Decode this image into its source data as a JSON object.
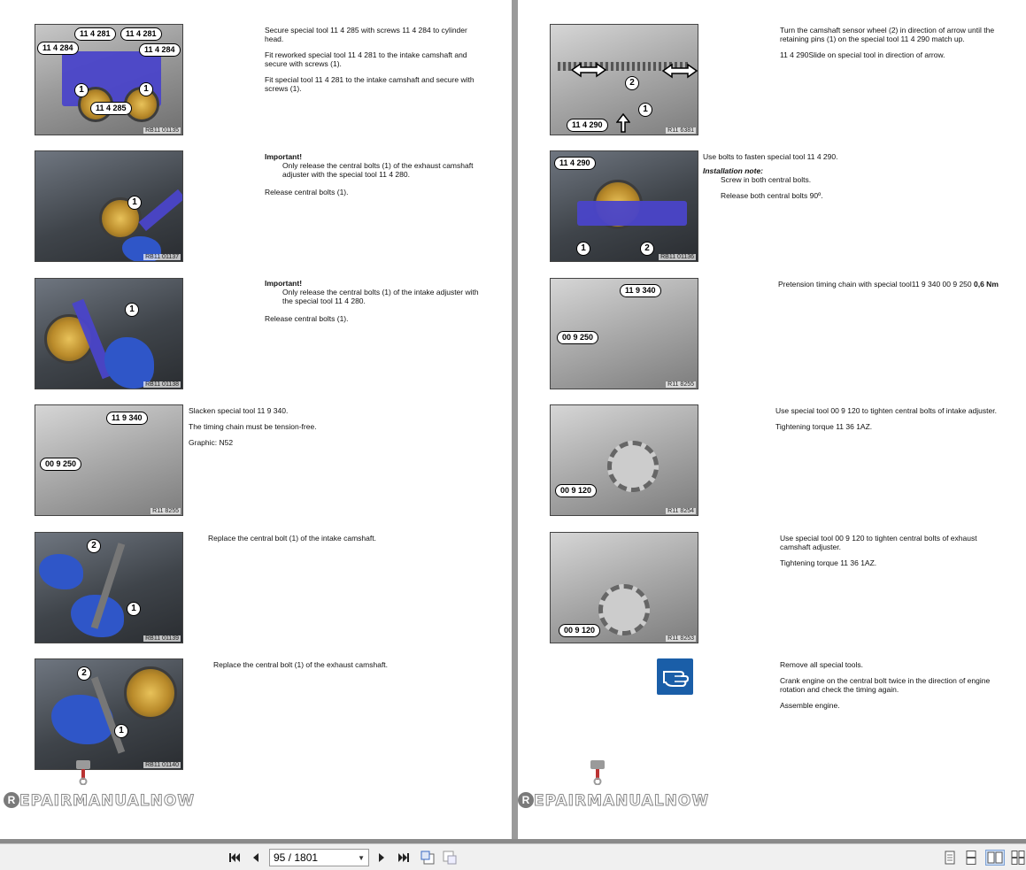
{
  "left_page": {
    "steps": [
      {
        "figure_ref": "RB11 01135",
        "labels": [
          "11 4 281",
          "11 4 281",
          "11 4 284",
          "11 4 284",
          "11 4 285"
        ],
        "numbers": [
          "1",
          "1"
        ],
        "paragraphs": [
          "Secure special tool 11 4 285 with screws 11 4 284 to cylinder head.",
          "Fit reworked special tool 11 4 281 to the intake camshaft and secure with screws (1).",
          "Fit special tool 11 4 281 to the intake camshaft and secure with screws (1)."
        ]
      },
      {
        "figure_ref": "RB11 01137",
        "numbers": [
          "1"
        ],
        "important": "Important!",
        "important_text": "Only release the central bolts (1) of the exhaust camshaft adjuster with the special tool 11 4 280.",
        "paragraphs": [
          "Release central bolts (1)."
        ]
      },
      {
        "figure_ref": "RB11 01138",
        "numbers": [
          "1"
        ],
        "important": "Important!",
        "important_text": "Only release the central bolts (1) of the intake adjuster with the special tool 11 4 280.",
        "paragraphs": [
          "Release central bolts (1)."
        ]
      },
      {
        "figure_ref": "R11 8255",
        "labels": [
          "11 9 340",
          "00 9 250"
        ],
        "paragraphs": [
          "Slacken special tool 11 9 340.",
          "The timing chain must be tension-free.",
          "Graphic: N52"
        ]
      },
      {
        "figure_ref": "RB11 01139",
        "numbers": [
          "2",
          "1"
        ],
        "paragraphs": [
          "Replace the central bolt (1) of the intake camshaft."
        ]
      },
      {
        "figure_ref": "RB11 01140",
        "numbers": [
          "2",
          "1"
        ],
        "paragraphs": [
          "Replace the central bolt (1) of the exhaust camshaft."
        ]
      }
    ]
  },
  "right_page": {
    "steps": [
      {
        "figure_ref": "R11 6381",
        "labels": [
          "11 4 290"
        ],
        "numbers": [
          "2",
          "1"
        ],
        "paragraphs": [
          "Turn the camshaft sensor wheel (2) in direction of arrow until the retaining pins (1) on the special tool 11 4 290 match up.",
          "11 4 290Slide on special tool in direction of arrow."
        ]
      },
      {
        "figure_ref": "RB11 01136",
        "labels": [
          "11 4 290"
        ],
        "numbers": [
          "1",
          "2"
        ],
        "paragraphs": [
          "Use bolts to fasten special tool 11 4 290."
        ],
        "note_title": "Installation note:",
        "note_lines": [
          "Screw in both central bolts.",
          "Release both central bolts 90º."
        ]
      },
      {
        "figure_ref": "R11 8255",
        "labels": [
          "11 9 340",
          "00 9 250"
        ],
        "paragraphs": [
          "Pretension timing chain with special tool11 9 340 00 9 250"
        ],
        "torque": "0,6 Nm"
      },
      {
        "figure_ref": "R11 8254",
        "labels": [
          "00 9 120"
        ],
        "paragraphs": [
          "Use special tool 00 9 120 to tighten central bolts of intake adjuster.",
          "Tightening torque 11 36 1AZ."
        ]
      },
      {
        "figure_ref": "R11 8253",
        "labels": [
          "00 9 120"
        ],
        "paragraphs": [
          "Use special tool 00 9 120 to tighten central bolts of exhaust camshaft adjuster.",
          "Tightening torque 11 36 1AZ."
        ]
      },
      {
        "paragraphs": [
          "Remove all special tools.",
          "Crank engine on the central bolt twice in the direction of engine rotation and check the timing again.",
          "Assemble engine."
        ]
      }
    ]
  },
  "watermark": {
    "letter": "R",
    "text": "EPAIRMANUALNOW"
  },
  "toolbar": {
    "page_indicator": "95 / 1801",
    "icons": [
      "first-page-icon",
      "prev-page-icon",
      "next-page-icon",
      "last-page-icon",
      "page-up-icon",
      "page-down-icon",
      "single-page-view-icon",
      "continuous-view-icon",
      "two-page-view-icon",
      "two-page-continuous-view-icon"
    ]
  },
  "colors": {
    "tool_blue": "#4a44c9",
    "hint_blue": "#1a5ea8",
    "gutter": "#9a9a9a"
  }
}
